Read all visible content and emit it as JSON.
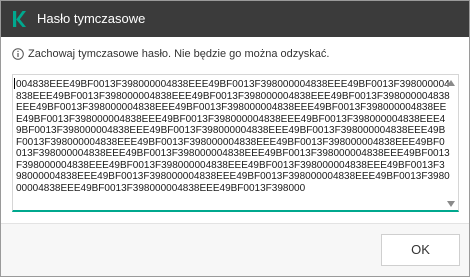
{
  "window": {
    "title": "Hasło tymczasowe",
    "icon": "kaspersky-k-icon",
    "accent_color": "#00a88e",
    "titlebar_color": "#3b3b3b"
  },
  "info": {
    "icon": "info-icon",
    "text": "Zachowaj tymczasowe hasło. Nie będzie go można odzyskać."
  },
  "password": {
    "value": "004838EEE49BF0013F398000004838EEE49BF0013F398000004838EEE49BF0013F398000004838EEE49BF0013F398000004838EEE49BF0013F398000004838EEE49BF0013F398000004838EEE49BF0013F398000004838EEE49BF0013F398000004838EEE49BF0013F398000004838EEE49BF0013F398000004838EEE49BF0013F398000004838EEE49BF0013F398000004838EEE49BF0013F398000004838EEE49BF0013F398000004838EEE49BF0013F398000004838EEE49BF0013F398000004838EEE49BF0013F398000004838EEE49BF0013F398000004838EEE49BF0013F398000004838EEE49BF0013F398000004838EEE49BF0013F398000004838EEE49BF0013F398000004838EEE49BF0013F398000004838EEE49BF0013F398000004838EEE49BF0013F398000004838EEE49BF0013F398000004838EEE49BF0013F398000004838EEE49BF0013F398000004838EEE49BF0013F398000004838EEE49BF0013F398000"
  },
  "footer": {
    "ok_label": "OK"
  }
}
